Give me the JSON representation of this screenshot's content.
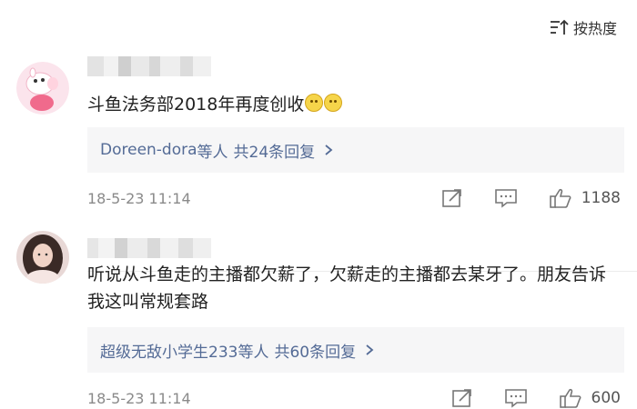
{
  "sort": {
    "label": "按热度",
    "icon": "sort-icon"
  },
  "comments": [
    {
      "avatar": "peppa-pig-avatar",
      "text": "斗鱼法务部2018年再度创收",
      "emojis": [
        "smile-emoji",
        "smile-emoji"
      ],
      "replies": {
        "users": "Doreen-dora",
        "suffix": "等人",
        "count": "共24条回复"
      },
      "time": "18-5-23 11:14",
      "likes": "1188"
    },
    {
      "avatar": "girl-photo-avatar",
      "text": "听说从斗鱼走的主播都欠薪了，欠薪走的主播都去某牙了。朋友告诉我这叫常规套路",
      "replies": {
        "users": "超级无敌小学生233",
        "suffix": "等人",
        "count": "共60条回复"
      },
      "time": "18-5-23 11:14",
      "likes": "600"
    }
  ],
  "colors": {
    "link": "#546b96",
    "meta": "#8a8a8a",
    "reply_bg": "#f6f6f7"
  }
}
